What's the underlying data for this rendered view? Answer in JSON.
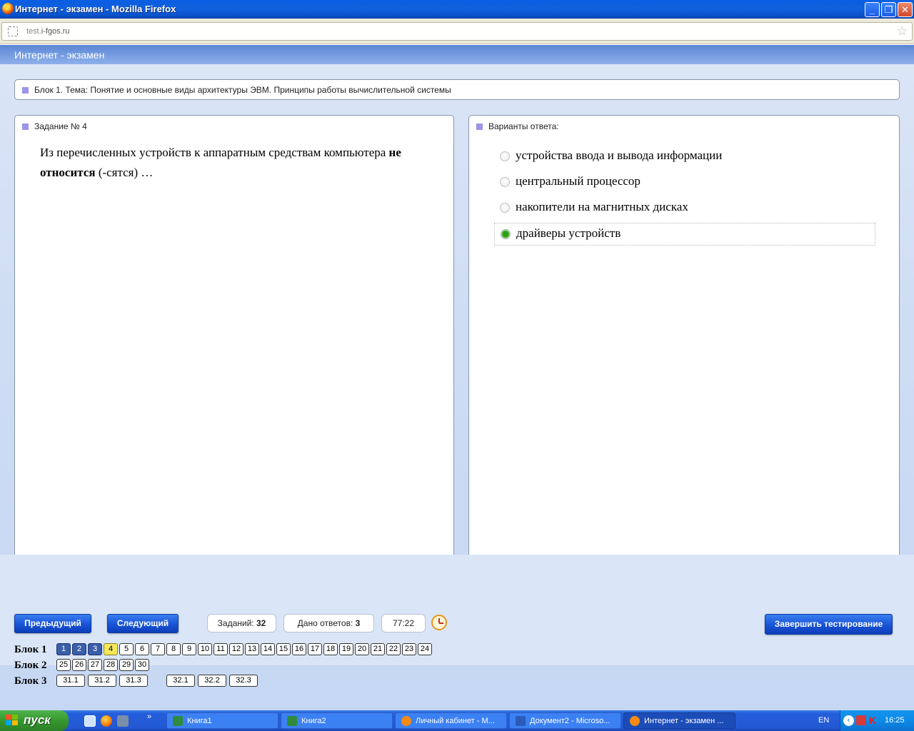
{
  "window": {
    "title": "Интернет - экзамен - Mozilla Firefox",
    "minimize": "_",
    "maximize": "❐",
    "close": "✕"
  },
  "address": {
    "url_prefix": "test.",
    "url_domain": "i-fgos.ru"
  },
  "page": {
    "header": "Интернет - экзамен",
    "topic": "Блок 1. Тема: Понятие и основные виды архитектуры ЭВМ. Принципы работы вычислительной системы",
    "task_label": "Задание № 4",
    "question_part1": "Из перечисленных устройств к аппаратным средствам компьютера ",
    "question_bold": "не относится",
    "question_part2": " (-сятся) …",
    "answers_label": "Варианты ответа:",
    "options": [
      {
        "label": "устройства ввода и вывода информации",
        "selected": false
      },
      {
        "label": "центральный процессор",
        "selected": false
      },
      {
        "label": "накопители на магнитных дисках",
        "selected": false
      },
      {
        "label": "драйверы устройств",
        "selected": true
      }
    ]
  },
  "controls": {
    "prev": "Предыдущий",
    "next": "Следующий",
    "tasks_label": "Заданий:",
    "tasks_count": "32",
    "answered_label": "Дано ответов:",
    "answered_count": "3",
    "timer": "77:22",
    "finish": "Завершить тестирование"
  },
  "blocks": [
    {
      "label": "Блок 1",
      "items": [
        "1",
        "2",
        "3",
        "4",
        "5",
        "6",
        "7",
        "8",
        "9",
        "10",
        "11",
        "12",
        "13",
        "14",
        "15",
        "16",
        "17",
        "18",
        "19",
        "20",
        "21",
        "22",
        "23",
        "24"
      ],
      "done": [
        "1",
        "2",
        "3"
      ],
      "current": "4"
    },
    {
      "label": "Блок 2",
      "items": [
        "25",
        "26",
        "27",
        "28",
        "29",
        "30"
      ],
      "done": [],
      "current": ""
    },
    {
      "label": "Блок 3",
      "items": [
        "31.1",
        "31.2",
        "31.3",
        "32.1",
        "32.2",
        "32.3"
      ],
      "done": [],
      "current": ""
    }
  ],
  "taskbar": {
    "start": "пуск",
    "tasks": [
      {
        "label": "Книга1",
        "icon": "excel-icon",
        "active": false
      },
      {
        "label": "Книга2",
        "icon": "excel-icon",
        "active": false
      },
      {
        "label": "Личный кабинет - M...",
        "icon": "firefox-icon",
        "active": false
      },
      {
        "label": "Документ2 - Microso...",
        "icon": "word-icon",
        "active": false
      },
      {
        "label": "Интернет - экзамен ...",
        "icon": "firefox-icon",
        "active": true
      }
    ],
    "lang": "EN",
    "time": "16:25"
  },
  "colors": {
    "accent_blue": "#1853d6",
    "answered_bg": "#3a5ea8",
    "current_bg": "#f5e85a",
    "selected_radio": "#2f9e16",
    "marker": "#9b95e9"
  }
}
